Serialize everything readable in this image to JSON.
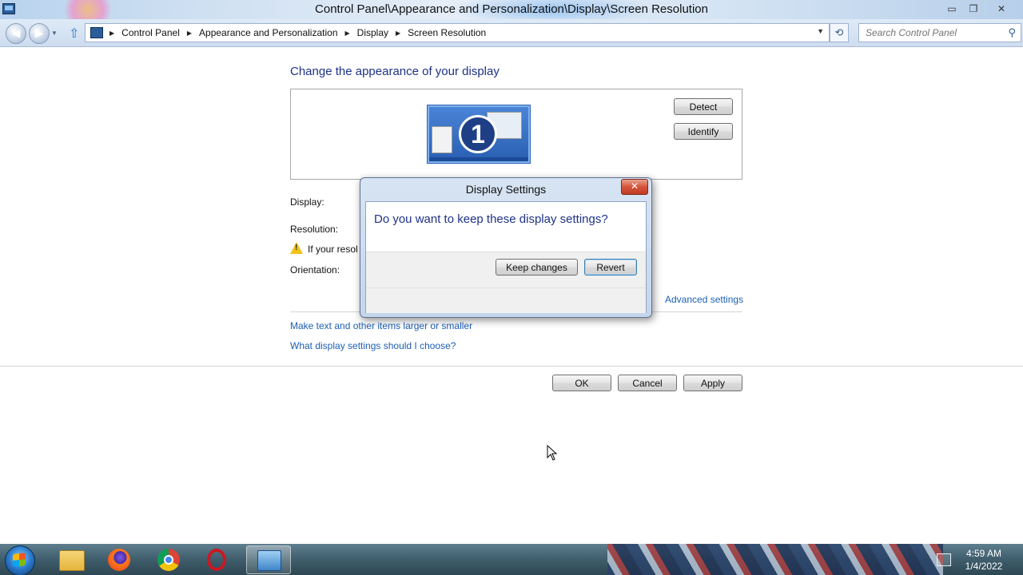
{
  "window": {
    "title": "Control Panel\\Appearance and Personalization\\Display\\Screen Resolution",
    "minimize_glyph": "▭",
    "maximize_glyph": "❐",
    "close_glyph": "✕"
  },
  "address": {
    "crumbs": [
      "Control Panel",
      "Appearance and Personalization",
      "Display",
      "Screen Resolution"
    ],
    "search_placeholder": "Search Control Panel"
  },
  "main": {
    "page_title": "Change the appearance of your display",
    "monitor_number": "1",
    "detect_label": "Detect",
    "identify_label": "Identify",
    "display_label": "Display:",
    "resolution_label": "Resolution:",
    "warning_text": "If your resol",
    "orientation_label": "Orientation:",
    "advanced_link": "Advanced settings",
    "larger_link": "Make text and other items larger or smaller",
    "choose_link": "What display settings should I choose?",
    "ok_label": "OK",
    "cancel_label": "Cancel",
    "apply_label": "Apply"
  },
  "dialog": {
    "title": "Display Settings",
    "message": "Do you want to keep these display settings?",
    "keep_label": "Keep changes",
    "revert_label": "Revert",
    "close_glyph": "✕"
  },
  "taskbar": {
    "apps": [
      "windows-explorer",
      "firefox",
      "chrome",
      "opera",
      "control-panel"
    ],
    "time": "4:59 AM",
    "date": "1/4/2022"
  },
  "colors": {
    "accent_title": "#1e3287",
    "link": "#1c5fb5"
  }
}
